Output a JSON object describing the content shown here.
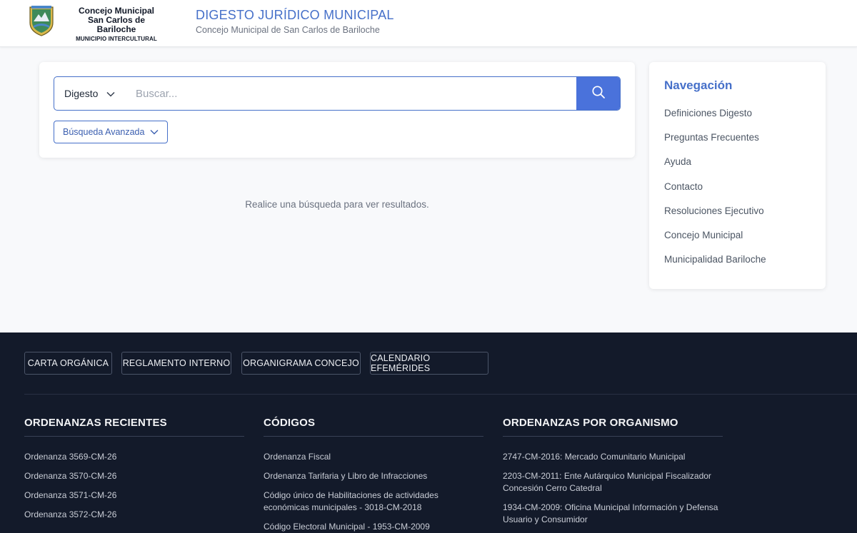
{
  "header": {
    "logo_line1": "Concejo Municipal",
    "logo_line2": "San Carlos de Bariloche",
    "logo_line3": "MUNICIPIO INTERCULTURAL",
    "title": "DIGESTO JURÍDICO MUNICIPAL",
    "subtitle": "Concejo Municipal de San Carlos de Bariloche"
  },
  "search": {
    "scope_value": "Digesto",
    "placeholder": "Buscar...",
    "advanced_label": "Búsqueda Avanzada"
  },
  "results": {
    "empty_message": "Realice una búsqueda para ver resultados."
  },
  "navigation": {
    "title": "Navegación",
    "items": [
      "Definiciones Digesto",
      "Preguntas Frecuentes",
      "Ayuda",
      "Contacto",
      "Resoluciones Ejecutivo",
      "Concejo Municipal",
      "Municipalidad Bariloche"
    ]
  },
  "footer": {
    "buttons": [
      "CARTA ORGÁNICA",
      "REGLAMENTO INTERNO",
      "ORGANIGRAMA CONCEJO",
      "CALENDARIO EFEMÉRIDES"
    ],
    "recent": {
      "title": "ORDENANZAS RECIENTES",
      "items": [
        "Ordenanza 3569-CM-26",
        "Ordenanza 3570-CM-26",
        "Ordenanza 3571-CM-26",
        "Ordenanza 3572-CM-26"
      ]
    },
    "codes": {
      "title": "CÓDIGOS",
      "items": [
        "Ordenanza Fiscal",
        "Ordenanza Tarifaria y Libro de Infracciones",
        "Código único de Habilitaciones de actividades económicas municipales - 3018-CM-2018",
        "Código Electoral Municipal - 1953-CM-2009"
      ]
    },
    "by_org": {
      "title": "ORDENANZAS POR ORGANISMO",
      "items": [
        "2747-CM-2016: Mercado Comunitario Municipal",
        "2203-CM-2011: Ente Autárquico Municipal Fiscalizador Concesión Cerro Catedral",
        "1934-CM-2009: Oficina Municipal Información y Defensa Usuario y Consumidor"
      ]
    }
  },
  "colors": {
    "accent": "#4670c9",
    "search_button": "#4a72db",
    "footer_bg": "#131a2a"
  },
  "icons": {
    "scope_chevron": "chevron-down-icon",
    "search": "search-icon",
    "advanced_chevron": "chevron-down-icon",
    "logo": "municipal-emblem"
  }
}
